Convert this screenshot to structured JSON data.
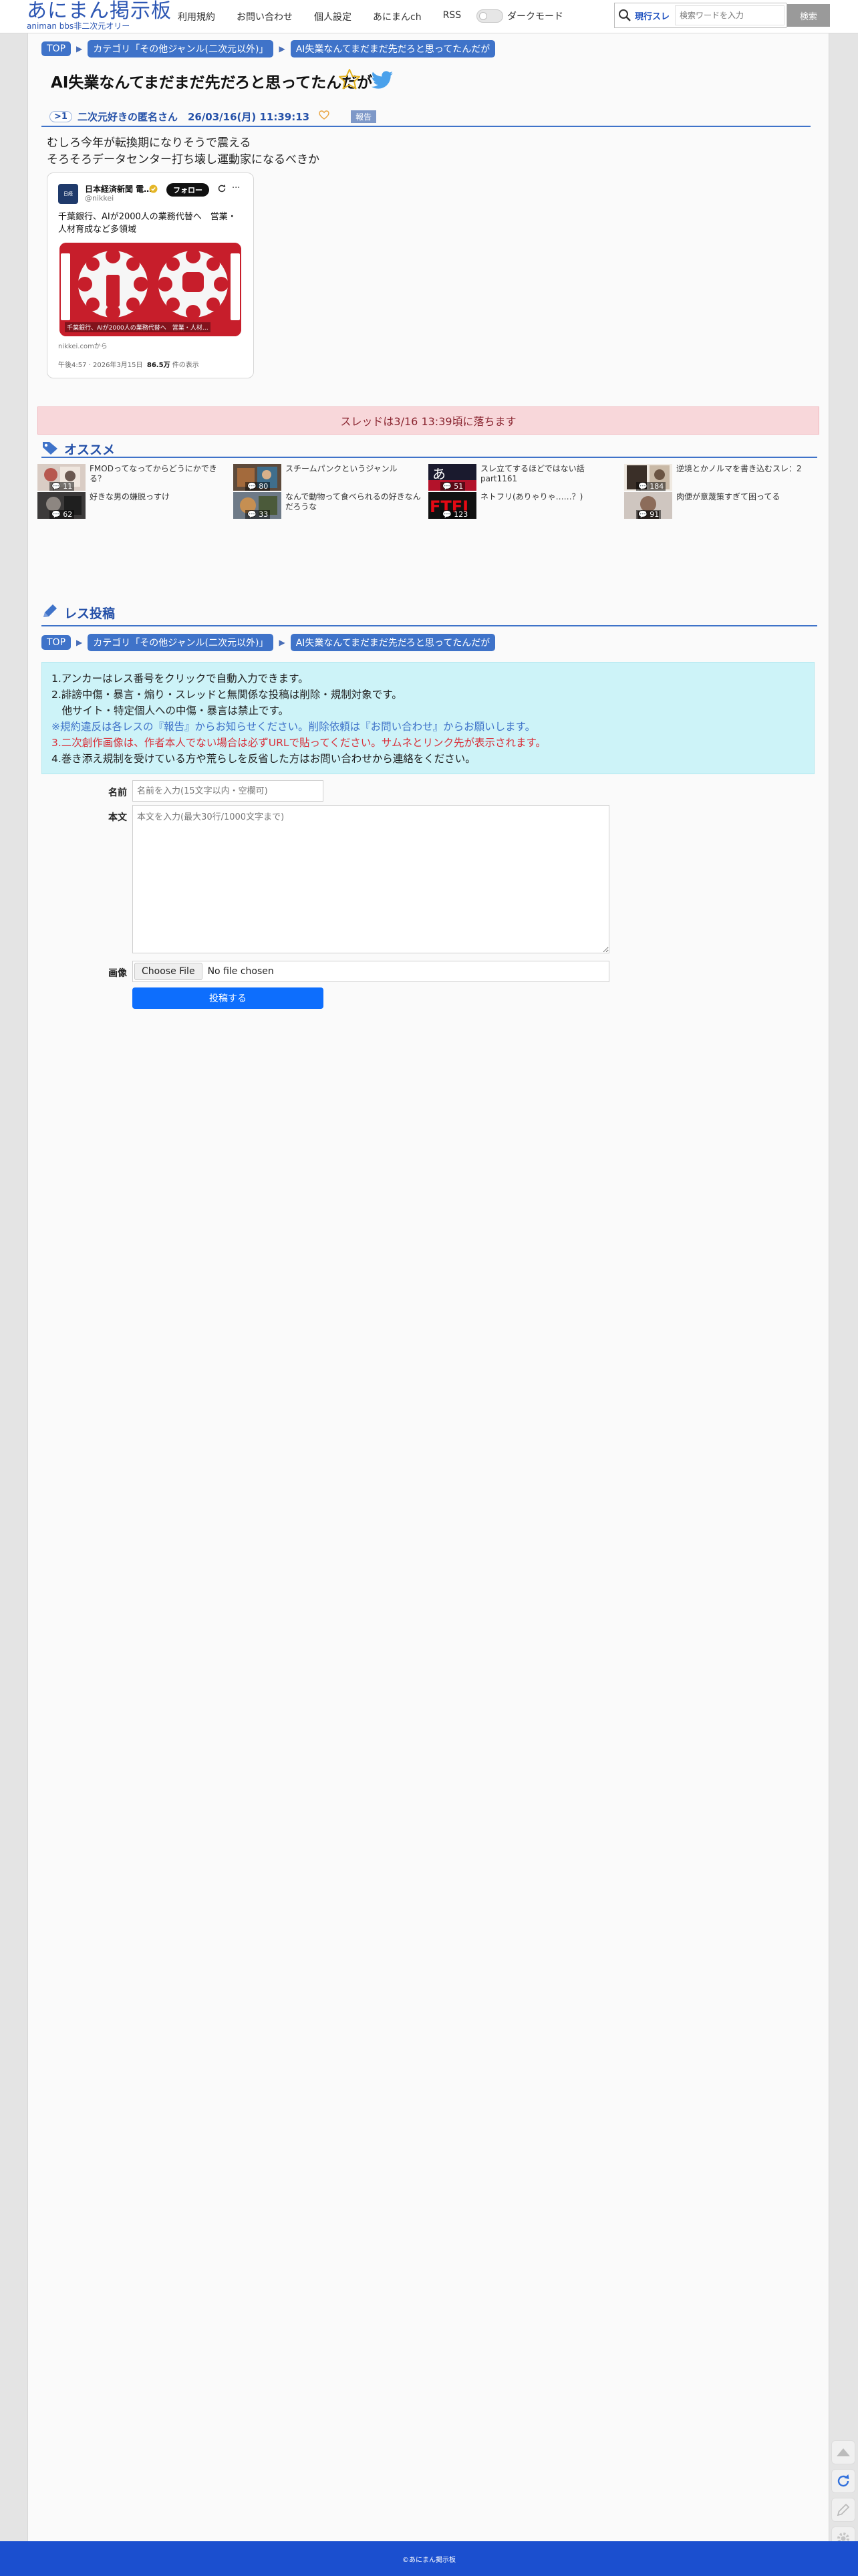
{
  "header": {
    "logo_main": "あにまん掲示板",
    "logo_sub": "animan bbs非二次元オリー",
    "nav": [
      "利用規約",
      "お問い合わせ",
      "個人設定",
      "あにまんch",
      "RSS"
    ],
    "dark_mode_label": "ダークモード",
    "search_mode": "現行スレ",
    "search_placeholder": "検索ワードを入力",
    "search_button": "検索"
  },
  "breadcrumb": [
    "TOP",
    "カテゴリ「その他ジャンル(二次元以外)」",
    "AI失業なんてまだまだ先だろと思ってたんだが"
  ],
  "thread": {
    "title": "AI失業なんてまだまだ先だろと思ってたんだが"
  },
  "post": {
    "number": ">1",
    "meta": "二次元好きの匿名さん　26/03/16(月) 11:39:13",
    "report_label": "報告",
    "body_lines": [
      "むしろ今年が転換期になりそうで震える",
      "そろそろデータセンター打ち壊し運動家になるべきか"
    ],
    "embed": {
      "avatar_text": "日経",
      "name": "日本経済新聞 電…",
      "handle": "@nikkei",
      "follow_label": "フォロー",
      "text": "千葉銀行、AIが2000人の業務代替へ　営業・人材育成など多領域",
      "image_caption": "千葉銀行、AIが2000人の業務代替へ　営業・人材…",
      "domain": "nikkei.comから",
      "time": "午後4:57 · 2026年3月15日",
      "views": "86.5万",
      "views_suffix": "件の表示"
    }
  },
  "drop_notice": "スレッドは3/16 13:39頃に落ちます",
  "recommend": {
    "title": "オススメ",
    "items": [
      {
        "title": "FMODってなってからどうにかできる？",
        "count": "11"
      },
      {
        "title": "スチームパンクというジャンル",
        "count": "80"
      },
      {
        "title": "スレ立てするほどではない話 part1161",
        "count": "51"
      },
      {
        "title": "逆境とかノルマを書き込むスレ：2",
        "count": "184"
      },
      {
        "title": "好きな男の嫌脱っすけ",
        "count": "62"
      },
      {
        "title": "なんで動物って食べられるの好きなんだろうな",
        "count": "33"
      },
      {
        "title": "ネトフリ(ありゃりゃ……？)",
        "count": "123"
      },
      {
        "title": "肉便が意蔑策すぎて困ってる",
        "count": "91"
      }
    ]
  },
  "reply": {
    "title": "レス投稿",
    "notice_lines": [
      "1.アンカーはレス番号をクリックで自動入力できます。",
      "2.誹謗中傷・暴言・煽り・スレッドと無関係な投稿は削除・規制対象です。",
      "　他サイト・特定個人への中傷・暴言は禁止です。",
      "※規約違反は各レスの『報告』からお知らせください。削除依頼は『お問い合わせ』からお願いします。",
      "3.二次創作画像は、作者本人でない場合は必ずURLで貼ってください。サムネとリンク先が表示されます。",
      "4.巻き添え規制を受けている方や荒らしを反省した方はお問い合わせから連絡をください。"
    ],
    "name_label": "名前",
    "name_placeholder": "名前を入力(15文字以内・空欄可)",
    "body_label": "本文",
    "body_placeholder": "本文を入力(最大30行/1000文字まで)",
    "image_label": "画像",
    "file_button": "Choose File",
    "file_none": "No file chosen",
    "submit_label": "投稿する"
  },
  "footer": {
    "copyright": "©あにまん掲示板"
  },
  "colors": {
    "brand_blue": "#2c56b3",
    "crumb_blue": "#3f73c9",
    "notice_cyan": "#cdf3f8",
    "drop_pink": "#f8d7da",
    "footer_blue": "#1b4fcf",
    "submit_blue": "#0d6efd"
  }
}
